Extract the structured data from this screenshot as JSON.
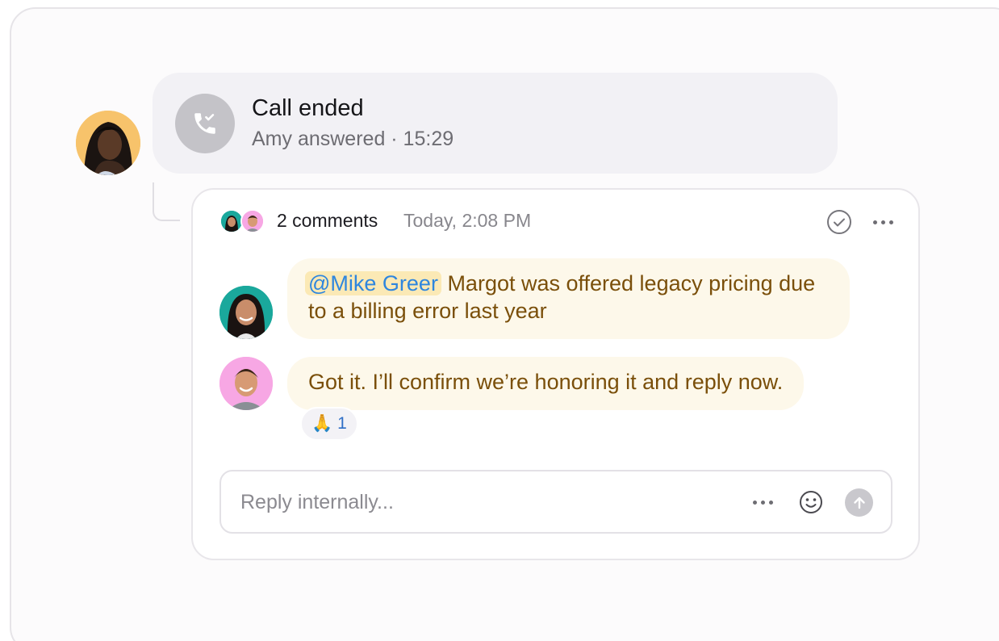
{
  "call": {
    "title": "Call ended",
    "subtitle": "Amy answered · 15:29",
    "icon": "phone-check-icon"
  },
  "thread": {
    "comment_count": "2 comments",
    "timestamp": "Today, 2:08 PM",
    "resolve_icon": "check-circle-icon",
    "more_icon": "more-horizontal-icon"
  },
  "comments": [
    {
      "mention": "@Mike Greer",
      "text": " Margot was offered legacy pricing due to a billing error last year",
      "avatar_color": "#1aa89c"
    },
    {
      "text": "Got it. I’ll confirm we’re honoring it and reply now.",
      "avatar_color": "#f7a7e4",
      "reaction": {
        "emoji": "🙏",
        "count": "1"
      }
    }
  ],
  "reply": {
    "placeholder": "Reply internally..."
  },
  "colors": {
    "bubble_bg": "#fdf8ea",
    "bubble_text": "#7a4f0a",
    "mention_text": "#2e86de",
    "mention_bg": "#fbe9b5",
    "caller_avatar_bg": "#f7c36b"
  }
}
